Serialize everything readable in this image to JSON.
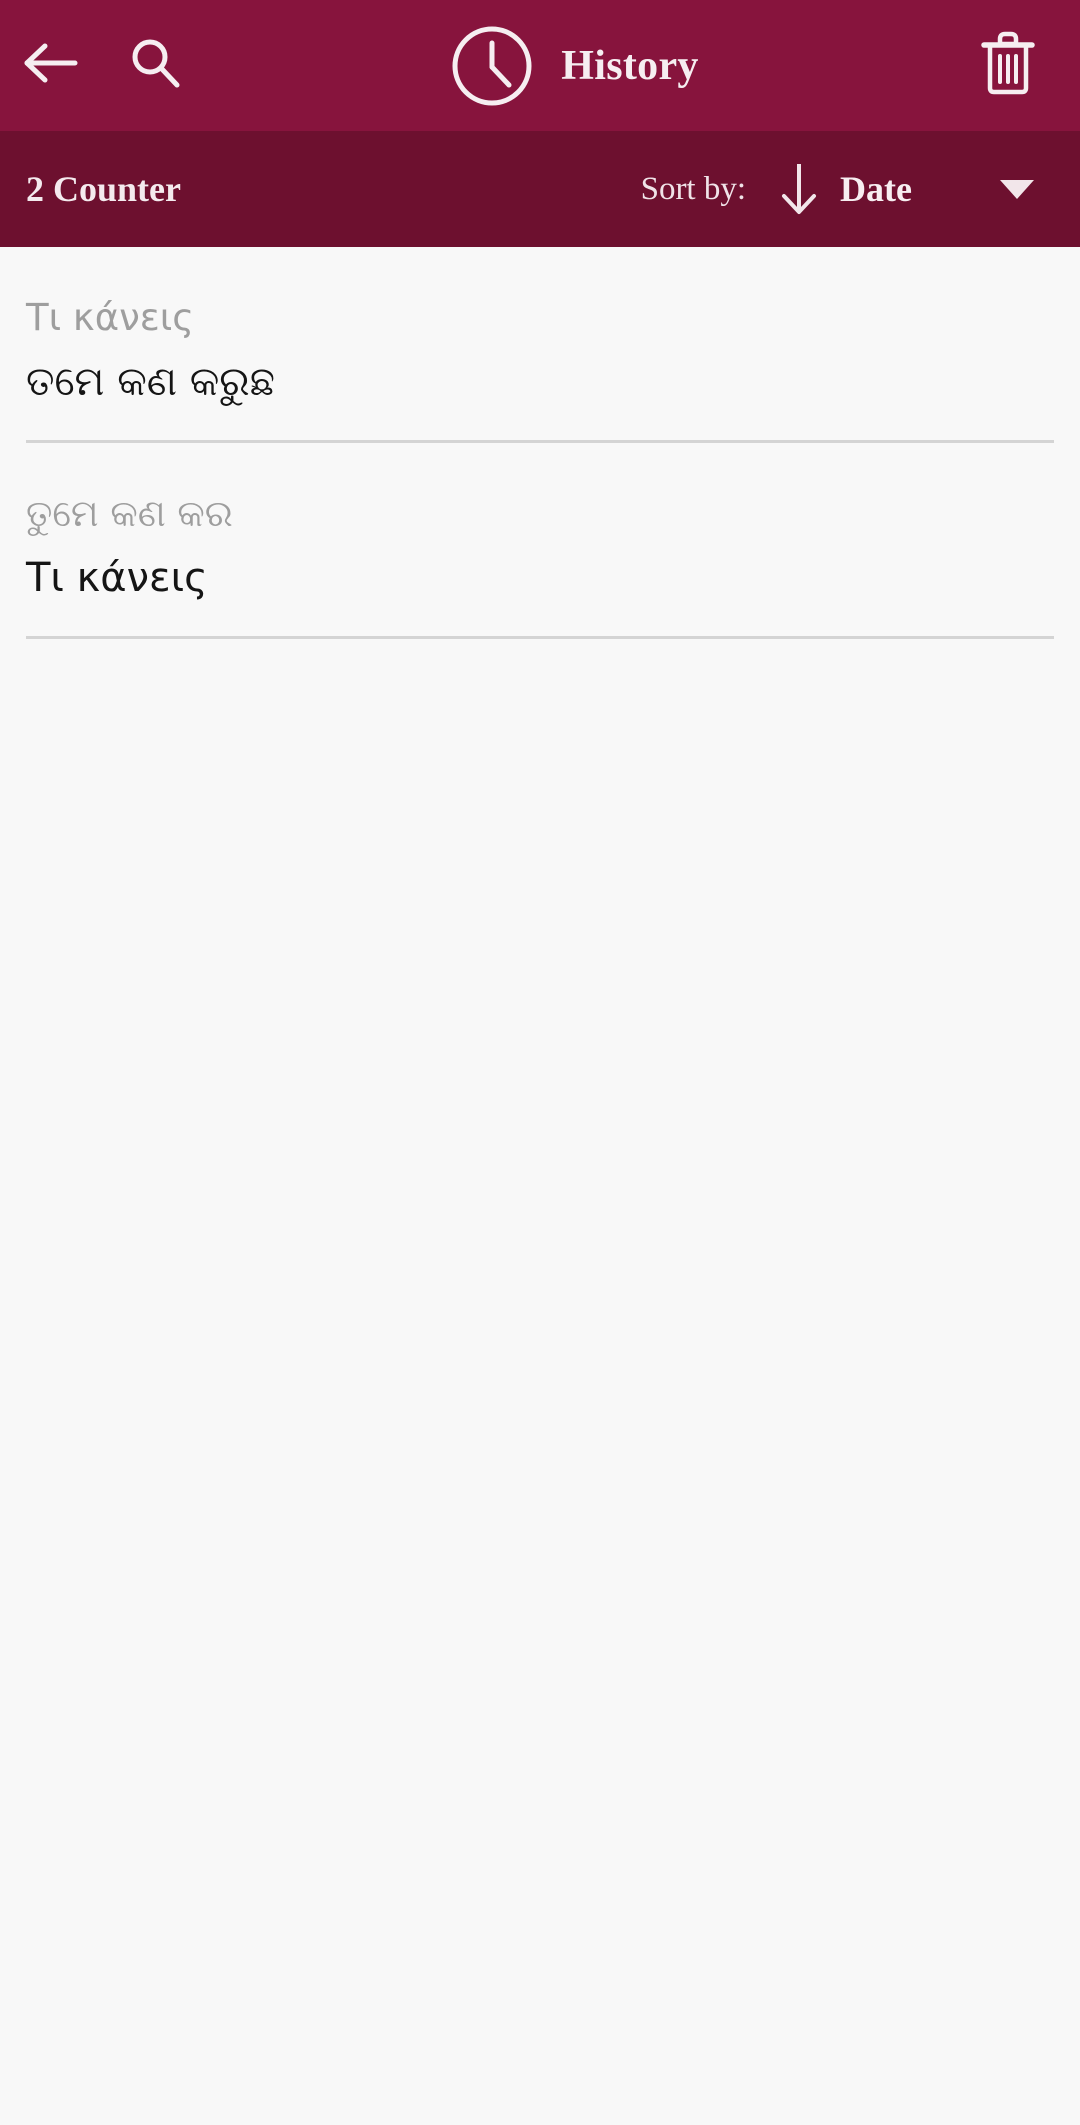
{
  "appbar": {
    "back_icon": "arrow-left-icon",
    "search_icon": "search-icon",
    "clock_icon": "clock-icon",
    "title": "History",
    "delete_icon": "trash-icon",
    "background_color": "#87143D",
    "text_color": "#F6EEF1"
  },
  "sortbar": {
    "counter": "2 Counter",
    "sort_by_label": "Sort by:",
    "sort_direction_icon": "arrow-down-icon",
    "sort_field": "Date",
    "dropdown_icon": "caret-down-icon",
    "background_color": "#6D102F"
  },
  "history": {
    "items": [
      {
        "source": "Τι κάνεις",
        "target": "ତମେ କଣ କରୁଛ"
      },
      {
        "source": "ତୁମେ କଣ କର",
        "target": "Τι κάνεις"
      }
    ]
  },
  "theme": {
    "page_background": "#F8F8F8",
    "divider_color": "#D4D4D4",
    "source_text_color": "#9E9E9E",
    "target_text_color": "#151515"
  }
}
